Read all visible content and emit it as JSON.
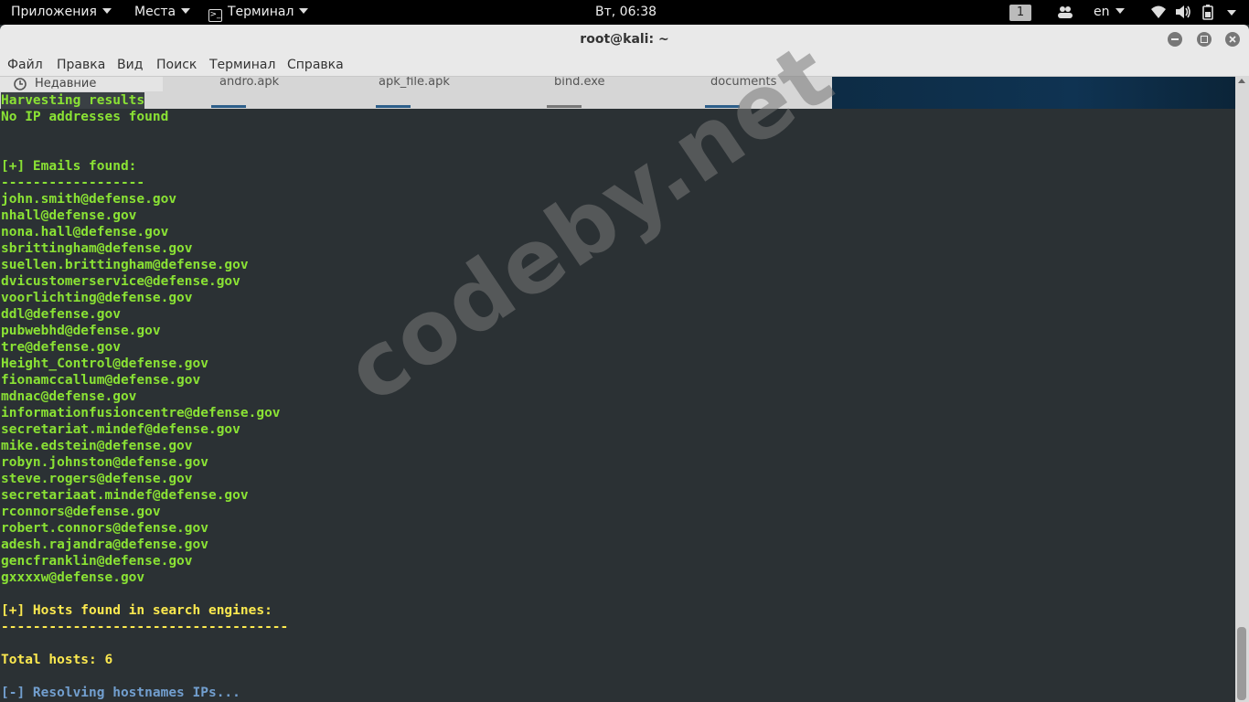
{
  "topbar": {
    "applications": "Приложения",
    "places": "Места",
    "terminal_app": "Терминал",
    "clock": "Вт, 06:38",
    "workspace": "1",
    "language": "en"
  },
  "window": {
    "title": "root@kali: ~"
  },
  "menu": [
    "Файл",
    "Правка",
    "Вид",
    "Поиск",
    "Терминал",
    "Справка"
  ],
  "background_window": {
    "recent": "Недавние",
    "files": [
      "andro.apk",
      "apk_file.apk",
      "bind.exe",
      "documents"
    ]
  },
  "terminal": {
    "lines": [
      {
        "text": "Harvesting results",
        "style": "green"
      },
      {
        "text": "No IP addresses found",
        "style": "green"
      },
      {
        "text": "",
        "style": "green"
      },
      {
        "text": "",
        "style": "green"
      },
      {
        "text": "[+] Emails found:",
        "style": "green"
      },
      {
        "text": "------------------",
        "style": "green"
      },
      {
        "text": "john.smith@defense.gov",
        "style": "green"
      },
      {
        "text": "nhall@defense.gov",
        "style": "green"
      },
      {
        "text": "nona.hall@defense.gov",
        "style": "green"
      },
      {
        "text": "sbrittingham@defense.gov",
        "style": "green"
      },
      {
        "text": "suellen.brittingham@defense.gov",
        "style": "green"
      },
      {
        "text": "dvicustomerservice@defense.gov",
        "style": "green"
      },
      {
        "text": "voorlichting@defense.gov",
        "style": "green"
      },
      {
        "text": "ddl@defense.gov",
        "style": "green"
      },
      {
        "text": "pubwebhd@defense.gov",
        "style": "green"
      },
      {
        "text": "tre@defense.gov",
        "style": "green"
      },
      {
        "text": "Height_Control@defense.gov",
        "style": "green"
      },
      {
        "text": "fionamccallum@defense.gov",
        "style": "green"
      },
      {
        "text": "mdnac@defense.gov",
        "style": "green"
      },
      {
        "text": "informationfusioncentre@defense.gov",
        "style": "green"
      },
      {
        "text": "secretariat.mindef@defense.gov",
        "style": "green"
      },
      {
        "text": "mike.edstein@defense.gov",
        "style": "green"
      },
      {
        "text": "robyn.johnston@defense.gov",
        "style": "green"
      },
      {
        "text": "steve.rogers@defense.gov",
        "style": "green"
      },
      {
        "text": "secretariaat.mindef@defense.gov",
        "style": "green"
      },
      {
        "text": "rconnors@defense.gov",
        "style": "green"
      },
      {
        "text": "robert.connors@defense.gov",
        "style": "green"
      },
      {
        "text": "adesh.rajandra@defense.gov",
        "style": "green"
      },
      {
        "text": "gencfranklin@defense.gov",
        "style": "green"
      },
      {
        "text": "gxxxxw@defense.gov",
        "style": "green"
      },
      {
        "text": "",
        "style": "green"
      },
      {
        "text": "[+] Hosts found in search engines:",
        "style": "yellow"
      },
      {
        "text": "------------------------------------",
        "style": "yellow"
      },
      {
        "text": "",
        "style": "yellow"
      },
      {
        "text": "Total hosts: 6",
        "style": "yellow"
      },
      {
        "text": "",
        "style": "yellow"
      },
      {
        "text": "[-] Resolving hostnames IPs...",
        "style": "blue"
      }
    ]
  },
  "watermark": "codeby.net",
  "colors": {
    "terminal_bg": "#2b3134",
    "green": "#8ae234",
    "yellow": "#fce94f",
    "blue": "#729fcf"
  }
}
